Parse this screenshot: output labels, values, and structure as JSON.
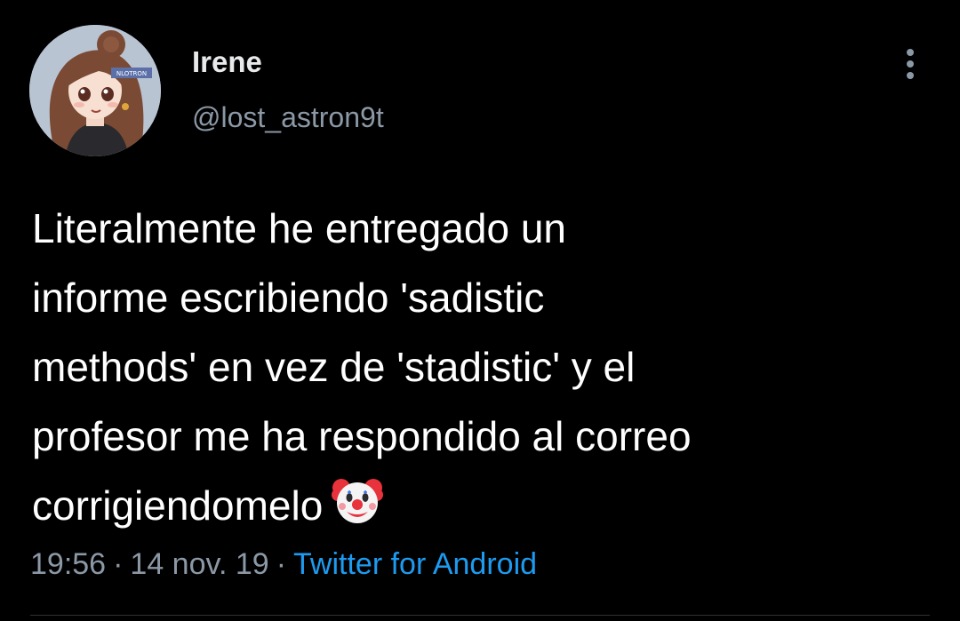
{
  "author": {
    "display_name": "Irene",
    "handle": "@lost_astron9t",
    "avatar_badge_text": "NLOTRON"
  },
  "tweet": {
    "text": "Literalmente he entregado un\ninforme escribiendo 'sadistic\nmethods' en vez de 'stadistic' y el\nprofesor me ha respondido al correo\ncorrigiendomelo",
    "emoji": "clown-face-emoji"
  },
  "meta": {
    "time": "19:56",
    "separator": "·",
    "date": "14 nov. 19",
    "source": "Twitter for Android"
  },
  "icons": {
    "more": "more-vertical-icon"
  },
  "colors": {
    "background": "#000000",
    "text": "#ffffff",
    "secondary": "#8b98a5",
    "link": "#1d9bf0"
  }
}
